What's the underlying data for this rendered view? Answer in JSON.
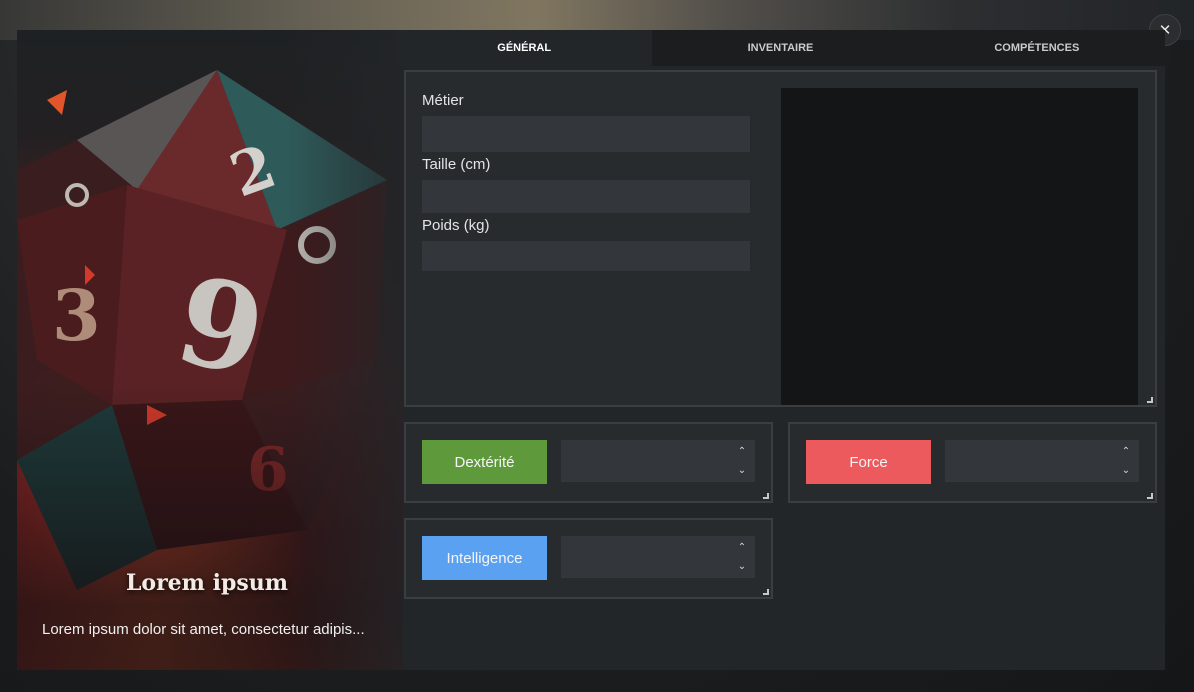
{
  "window": {
    "close_icon": "close-icon",
    "close_glyph": "✕"
  },
  "art": {
    "title": "Lorem ipsum",
    "description": "Lorem ipsum dolor sit amet, consectetur adipis..."
  },
  "tabs": [
    {
      "label": "GÉNÉRAL",
      "active": true
    },
    {
      "label": "INVENTAIRE",
      "active": false
    },
    {
      "label": "COMPÉTENCES",
      "active": false
    }
  ],
  "general": {
    "fields": [
      {
        "label": "Métier",
        "value": ""
      },
      {
        "label": "Taille (cm)",
        "value": ""
      },
      {
        "label": "Poids (kg)",
        "value": ""
      }
    ]
  },
  "stats": [
    {
      "label": "Dextérité",
      "value": "",
      "color": "#5e9a3c"
    },
    {
      "label": "Force",
      "value": "",
      "color": "#ec5a5d"
    },
    {
      "label": "Intelligence",
      "value": "",
      "color": "#5aa2f1"
    }
  ],
  "spinner": {
    "up": "⌃",
    "down": "⌄"
  },
  "colors": {
    "modal_bg": "#232629",
    "panel_bg": "#282b2e",
    "input_bg": "#33363a",
    "preview_bg": "#141517"
  }
}
